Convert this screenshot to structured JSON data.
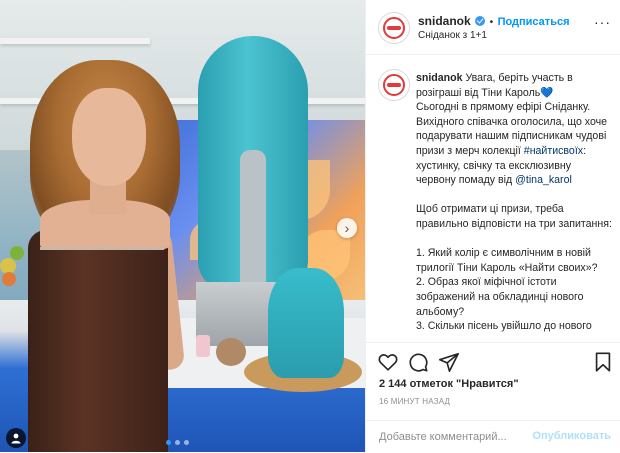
{
  "post": {
    "username": "snidanok",
    "follow_label": "Подписаться",
    "separator": "•",
    "location": "Сніданок з 1+1",
    "more_label": "···"
  },
  "caption": {
    "username": "snidanok",
    "part1": "Увага, беріть участь в розіграші від Тіни Кароль",
    "heart": "💙",
    "part2": "Сьогодні в прямому ефірі Сніданку. Вихідного співачка оголосила, що хоче подарувати нашим підписникам чудові призи з мерч колекції ",
    "hashtag": "#найтисвоїх",
    "part3": ": хустинку, свічку та ексклюзивну червону помаду від ",
    "mention": "@tina_karol",
    "paragraph2": "Щоб отримати ці призи, треба правильно відповісти на три запитання:",
    "q1": "1. Який колір є символічним в новій трилогії Тіни Кароль «Найти своих»?",
    "q2": "2. Образ якої міфічної істоти зображений на обкладинці нового альбому?",
    "q3": "3. Скільки пісень увійшло до нового"
  },
  "stats": {
    "likes": "2 144 отметок \"Нравится\"",
    "time": "16 МИНУТ НАЗАД"
  },
  "comment": {
    "placeholder": "Добавьте комментарий...",
    "publish_label": "Опубликовать"
  },
  "icons": {
    "like": "heart-icon",
    "comment": "comment-icon",
    "share": "share-icon",
    "save": "bookmark-icon",
    "verified": "verified-badge-icon",
    "tag": "user-tag-icon",
    "next": "chevron-right-icon"
  },
  "carousel": {
    "current": 1,
    "total": 3
  },
  "colors": {
    "link": "#00376b",
    "follow": "#0095f6",
    "verified": "#3897f0",
    "publish_disabled": "#b2dffc",
    "muted": "#8e8e8e"
  }
}
